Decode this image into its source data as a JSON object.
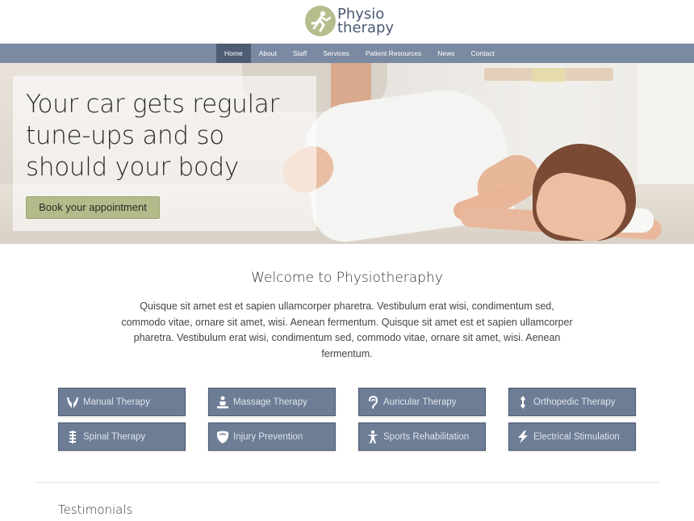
{
  "brand": {
    "line1": "Physio",
    "line2": "therapy",
    "accent": "#b6bd8c",
    "text_color": "#4b5a73"
  },
  "nav": {
    "background": "#7a8aa2",
    "active_background": "#4e5d74",
    "items": [
      {
        "label": "Home",
        "active": true
      },
      {
        "label": "About",
        "active": false
      },
      {
        "label": "Staff",
        "active": false
      },
      {
        "label": "Services",
        "active": false
      },
      {
        "label": "Patient Resources",
        "active": false
      },
      {
        "label": "News",
        "active": false
      },
      {
        "label": "Contact",
        "active": false
      }
    ]
  },
  "hero": {
    "title_line1": "Your car gets regular",
    "title_line2": "tune-ups and so",
    "title_line3": "should your body",
    "cta_label": "Book your appointment",
    "cta_color": "#b3bb8a"
  },
  "welcome": {
    "title": "Welcome to Physiotheraphy",
    "body": "Quisque sit amet est et sapien ullamcorper pharetra. Vestibulum erat wisi, condimentum sed, commodo vitae, ornare sit amet, wisi. Aenean fermentum. Quisque sit amet est et sapien ullamcorper pharetra. Vestibulum erat wisi, condimentum sed, commodo vitae, ornare sit amet, wisi. Aenean fermentum."
  },
  "services": {
    "button_color": "#6d7d96",
    "items": [
      {
        "label": "Manual Therapy",
        "icon": "hands-icon"
      },
      {
        "label": "Massage Therapy",
        "icon": "massage-icon"
      },
      {
        "label": "Auricular Therapy",
        "icon": "ear-icon"
      },
      {
        "label": "Orthopedic Therapy",
        "icon": "bone-icon"
      },
      {
        "label": "Spinal Therapy",
        "icon": "spine-icon"
      },
      {
        "label": "Injury Prevention",
        "icon": "shield-icon"
      },
      {
        "label": "Sports Rehabilitation",
        "icon": "person-icon"
      },
      {
        "label": "Electrical Stimulation",
        "icon": "lightning-icon"
      }
    ]
  },
  "testimonials": {
    "title": "Testimonials"
  }
}
